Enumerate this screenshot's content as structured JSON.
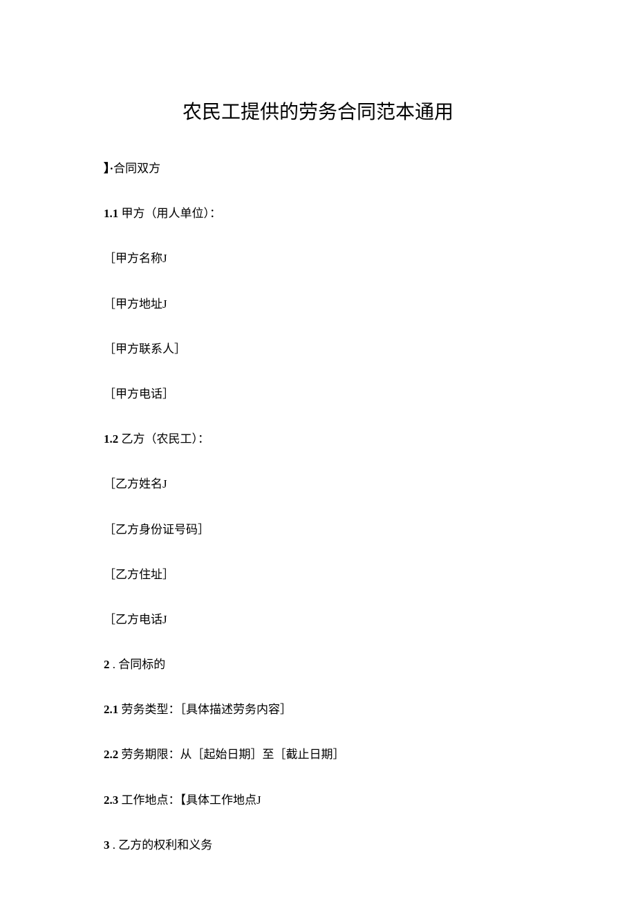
{
  "title": "农民工提供的劳务合同范本通用",
  "section1_header": "】·合同双方",
  "s1_1_num": "1.1",
  "s1_1_text": " 甲方（用人单位）：",
  "s1_field1": "［甲方名称J",
  "s1_field2": "［甲方地址J",
  "s1_field3": "［甲方联系人］",
  "s1_field4": "［甲方电话］",
  "s1_2_num": "1.2",
  "s1_2_text": " 乙方（农民工）：",
  "s2_field1": "［乙方姓名J",
  "s2_field2": "［乙方身份证号码］",
  "s2_field3": "［乙方住址］",
  "s2_field4": "［乙方电话J",
  "section2_num": "2",
  "section2_text": " . 合同标的",
  "s2_1_num": "2.1",
  "s2_1_text": " 劳务类型：［具体描述劳务内容］",
  "s2_2_num": "2.2",
  "s2_2_text": "  劳务期限：从［起始日期］至［截止日期］",
  "s2_3_num": "2.3",
  "s2_3_text": "  工作地点：【具体工作地点J",
  "section3_num": "3",
  "section3_text": "  . 乙方的权利和义务"
}
